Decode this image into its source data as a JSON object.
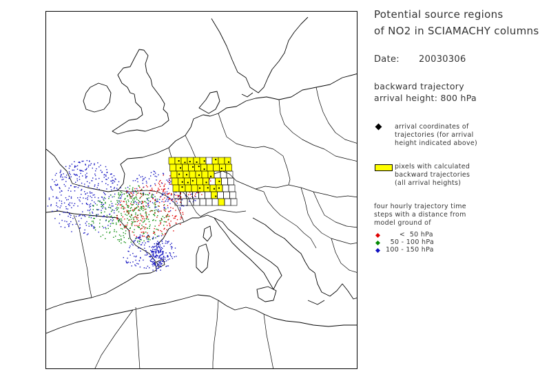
{
  "title_line1": "Potential source regions",
  "title_line2": "of NO2 in SCIAMACHY columns",
  "date_label": "Date:",
  "date_value": "20030306",
  "trajectory_line1": "backward trajectory",
  "trajectory_line2": "arrival height:  800  hPa",
  "legend": {
    "arrival_line1": "arrival coordinates of",
    "arrival_line2": "trajectories (for arrival",
    "arrival_line3": "height indicated above)",
    "pixels_line1": "pixels with calculated",
    "pixels_line2": "backward trajectories",
    "pixels_line3": "(all arrival heights)",
    "steps_line1": "four hourly trajectory time",
    "steps_line2": "steps with a distance from",
    "steps_line3": "model ground of",
    "range_red": "      <  50 hPa",
    "range_green": "  50 - 100 hPa",
    "range_blue": "100 - 150 hPa"
  },
  "colors": {
    "arrival": "#000000",
    "pixel_fill": "#ffff00",
    "red": "#e00000",
    "green": "#008800",
    "blue": "#1010c0"
  }
}
